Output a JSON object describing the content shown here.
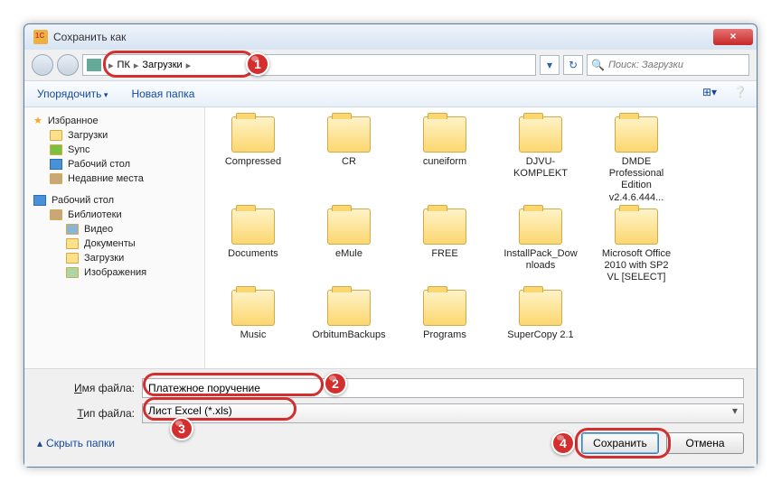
{
  "title": "Сохранить как",
  "breadcrumb": {
    "root": "ПК",
    "folder": "Загрузки"
  },
  "search_placeholder": "Поиск: Загрузки",
  "toolbar": {
    "organize": "Упорядочить",
    "newfolder": "Новая папка"
  },
  "sidebar": {
    "favorites": "Избранное",
    "fav_items": [
      "Загрузки",
      "Sync",
      "Рабочий стол",
      "Недавние места"
    ],
    "desktop": "Рабочий стол",
    "libs": "Библиотеки",
    "lib_items": [
      "Видео",
      "Документы",
      "Загрузки",
      "Изображения"
    ]
  },
  "folders": [
    "Compressed",
    "CR",
    "cuneiform",
    "DJVU-KOMPLEKT",
    "DMDE Professional Edition v2.4.6.444...",
    "Documents",
    "eMule",
    "FREE",
    "InstallPack_Downloads",
    "Microsoft Office 2010 with SP2 VL [SELECT]",
    "Music",
    "OrbitumBackups",
    "Programs",
    "SuperCopy 2.1"
  ],
  "filename_label": "Имя файла:",
  "filename_value": "Платежное поручение",
  "filetype_label": "Тип файла:",
  "filetype_value": "Лист Excel (*.xls)",
  "hide_folders": "Скрыть папки",
  "save_btn": "Сохранить",
  "cancel_btn": "Отмена",
  "annotations": [
    "1",
    "2",
    "3",
    "4"
  ]
}
